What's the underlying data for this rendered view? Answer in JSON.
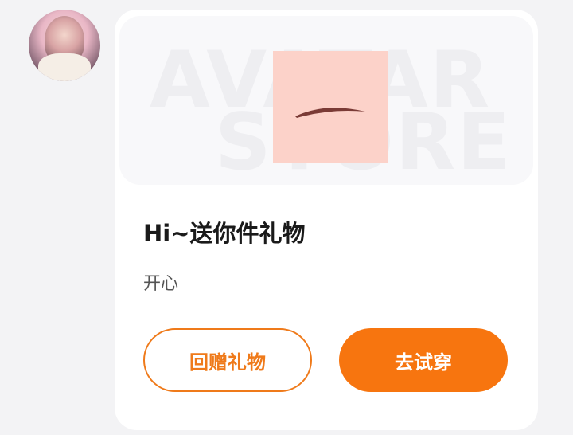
{
  "sender": {
    "avatar_icon": "user-avatar-icon"
  },
  "gift_card": {
    "banner": {
      "watermark_line1": "AVATAR",
      "watermark_line2": "STORE",
      "product_icon": "eyebrow-icon",
      "product_bg_color": "#fcd2c9",
      "brow_color": "#7a3b36"
    },
    "title": "Hi~送你件礼物",
    "message": "开心",
    "buttons": {
      "return_gift_label": "回赠礼物",
      "try_on_label": "去试穿"
    },
    "colors": {
      "accent": "#f7750f",
      "accent_outline": "#ef7a1a"
    }
  }
}
